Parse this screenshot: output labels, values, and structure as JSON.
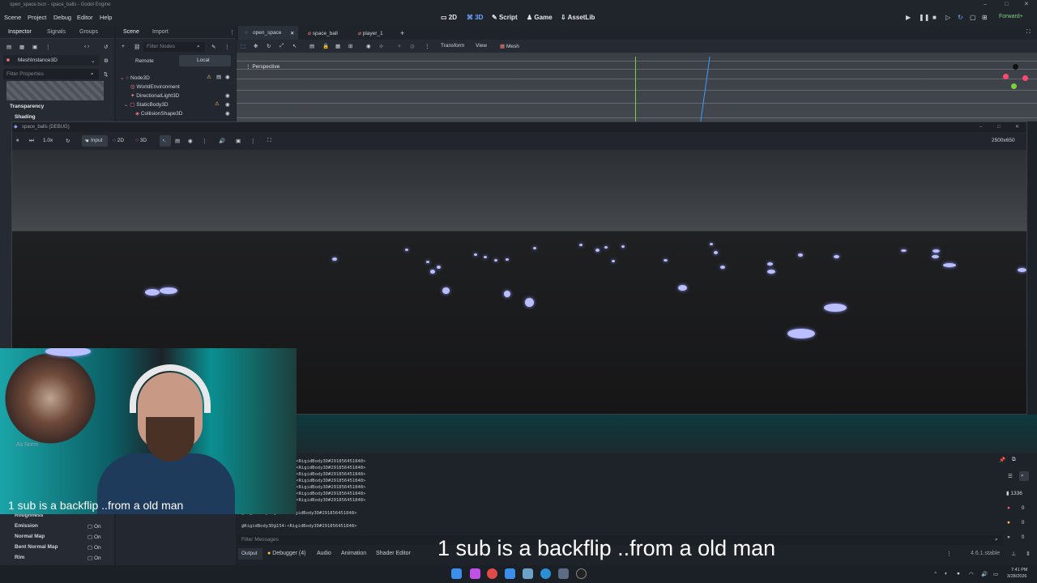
{
  "window": {
    "title": "open_space.tscn - space_balls - Godot Engine"
  },
  "menu": [
    "Scene",
    "Project",
    "Debug",
    "Editor",
    "Help"
  ],
  "workspaces": [
    "2D",
    "3D",
    "Script",
    "Game",
    "AssetLib"
  ],
  "renderer": "Forward+",
  "inspector": {
    "tabs": [
      "Inspector",
      "Signals",
      "Groups"
    ],
    "node": "MeshInstance3D",
    "filter_placeholder": "Filter Properties",
    "sections": [
      "Transparency",
      "Shading"
    ],
    "props": [
      {
        "label": "Roughness",
        "value": ""
      },
      {
        "label": "Emission",
        "value": "On"
      },
      {
        "label": "Normal Map",
        "value": "On"
      },
      {
        "label": "Bent Normal Map",
        "value": "On"
      },
      {
        "label": "Rim",
        "value": "On"
      }
    ]
  },
  "scene": {
    "tabs": [
      "Scene",
      "Import"
    ],
    "filter_placeholder": "Filter Nodes",
    "remote": "Remote",
    "local": "Local",
    "tree": [
      "Node3D",
      "WorldEnvironment",
      "DirectionalLight3D",
      "StaticBody3D",
      "CollisionShape3D"
    ]
  },
  "editor_tabs": [
    "open_space",
    "space_ball",
    "player_1"
  ],
  "viewport": {
    "menus": [
      "Transform",
      "View",
      "Mesh"
    ],
    "label": "Perspective"
  },
  "game_window": {
    "title": "space_balls (DEBUG)",
    "speed": "1.0x",
    "input": "Input",
    "modes": [
      "2D",
      "3D"
    ],
    "resolution": "2500x650"
  },
  "output": {
    "lines": [
      ":<RigidBody3D#291856451848>",
      ":<RigidBody3D#291856451848>",
      ":<RigidBody3D#291856451848>",
      ":<RigidBody3D#291856451848>",
      ":<RigidBody3D#291856451848>",
      ":<RigidBody3D#291856451848>",
      ":<RigidBody3D#291856451848>",
      "@RigidBody3D@154:<RigidBody3D#291856451848>",
      "@RigidBody3D@154:<RigidBody3D#291856451848>"
    ],
    "filter_placeholder": "Filter Messages",
    "tabs": [
      "Output",
      "Debugger (4)",
      "Audio",
      "Animation",
      "Shader Editor"
    ],
    "counts": [
      "1336",
      "0",
      "0",
      "0"
    ],
    "version": "4.6.1.stable"
  },
  "captions": {
    "small": "1 sub is a backflip ..from a old man",
    "large": "1 sub is a backflip ..from a old man"
  },
  "webcam_overlay_text": "As Norm",
  "clock": {
    "time": "7:41 PM",
    "date": "3/28/2026"
  },
  "colors": {
    "accent": "#6eaaff",
    "node_red": "#fc7f7f",
    "warning": "#ffcc44"
  }
}
